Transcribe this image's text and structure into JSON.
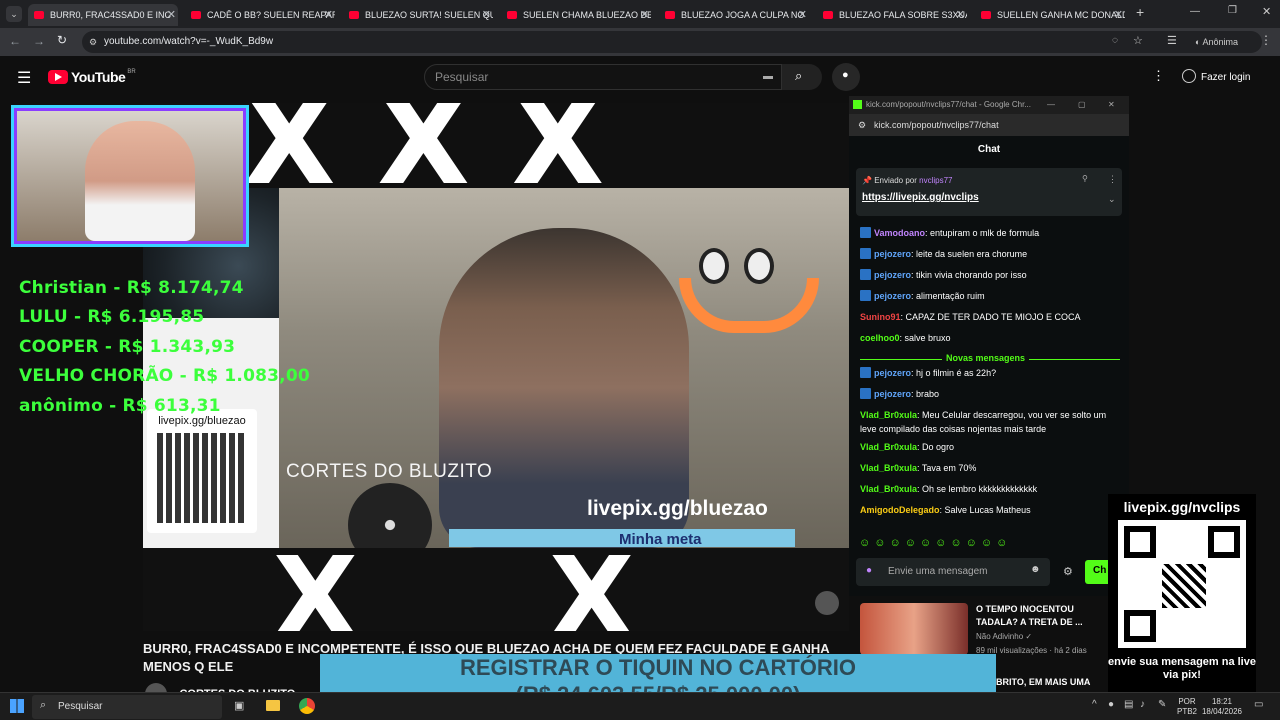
{
  "browser": {
    "tabs": [
      {
        "label": "BURR0, FRAC4SSAD0 E INC",
        "active": true
      },
      {
        "label": "CADÊ O BB? SUELEN REAPARE"
      },
      {
        "label": "BLUEZAO SURTA! SUELEN QUE"
      },
      {
        "label": "SUELEN CHAMA BLUEZAO DE"
      },
      {
        "label": "BLUEZAO JOGA A CULPA NO"
      },
      {
        "label": "BLUEZAO FALA SOBRE S3XUAL"
      },
      {
        "label": "SUELLEN GANHA MC DONALD"
      }
    ],
    "url": "youtube.com/watch?v=-_WudK_Bd9w",
    "profile_label": "Anônima"
  },
  "youtube": {
    "logo": "YouTube",
    "region": "BR",
    "search_placeholder": "Pesquisar",
    "login_label": "Fazer login"
  },
  "video": {
    "title": "BURR0, FRAC4SSAD0 E INCOMPETENTE, É ISSO QUE BLUEZAO ACHA DE QUEM FEZ FACULDADE E GANHA MENOS Q ELE",
    "channel": "CORTES DO BLUZITO",
    "overlay_channel_text": "CORTES DO BLUZITO",
    "livepix_text": "livepix.gg/bluezao",
    "meta_label": "Minha meta",
    "qr_label": "livepix.gg/bluezao",
    "donors": [
      "Christian - R$ 8.174,74",
      "LULU - R$ 6.195,85",
      "COOPER - R$ 1.343,93",
      "VELHO CHORÃO - R$ 1.083,00",
      "anônimo - R$ 613,31"
    ]
  },
  "chat_popup": {
    "window_title": "kick.com/popout/nvclips77/chat - Google Chr...",
    "url": "kick.com/popout/nvclips77/chat",
    "header": "Chat",
    "pinned_label": "Enviado por",
    "pinned_user": "nvclips77",
    "pinned_link": "https://livepix.gg/nvclips",
    "new_messages_label": "Novas mensagens",
    "input_placeholder": "Envie uma mensagem",
    "send_label": "Ch",
    "messages": [
      {
        "user": "Vamodoano",
        "text": "entupiram o mlk de formula",
        "color": "#c084fc",
        "badge": true
      },
      {
        "user": "pejozero",
        "text": "leite da suelen era chorume",
        "color": "#60a5fa",
        "badge": true
      },
      {
        "user": "pejozero",
        "text": "tikin vivia chorando por isso",
        "color": "#60a5fa",
        "badge": true
      },
      {
        "user": "pejozero",
        "text": "alimentação ruim",
        "color": "#60a5fa",
        "badge": true
      },
      {
        "user": "Sunino91",
        "text": "CAPAZ DE TER DADO TE MIOJO E COCA",
        "color": "#ef4444",
        "badge": false
      },
      {
        "user": "coelhoo0",
        "text": "salve bruxo",
        "color": "#53fc18",
        "badge": false
      },
      {
        "user": "pejozero",
        "text": "hj o filmin é as 22h?",
        "color": "#60a5fa",
        "badge": true
      },
      {
        "user": "pejozero",
        "text": "brabo",
        "color": "#60a5fa",
        "badge": true
      },
      {
        "user": "Vlad_Br0xula",
        "text": "Meu Celular descarregou, vou ver se solto um leve compilado das coisas nojentas mais tarde",
        "color": "#53fc18",
        "badge": false
      },
      {
        "user": "Vlad_Br0xula",
        "text": "Do ogro",
        "color": "#53fc18",
        "badge": false
      },
      {
        "user": "Vlad_Br0xula",
        "text": "Tava em 70%",
        "color": "#53fc18",
        "badge": false
      },
      {
        "user": "Vlad_Br0xula",
        "text": "Oh se lembro kkkkkkkkkkkkk",
        "color": "#53fc18",
        "badge": false
      },
      {
        "user": "AmigodoDelegado",
        "text": "Salve Lucas Matheus",
        "color": "#facc15",
        "badge": false
      }
    ]
  },
  "sidebar_recs": [
    {
      "title": "O TEMPO INOCENTOU TADALA? A TRETA DE ...",
      "channel": "Não Adivinho",
      "meta": "89 mil visualizações · há 2 dias"
    },
    {
      "title": "BRITO, EM MAIS UMA",
      "channel": "",
      "meta": ""
    }
  ],
  "qr_overlay": {
    "top_text": "livepix.gg/nvclips",
    "bottom_text": "envie sua mensagem na live via pix!"
  },
  "goal_banner": {
    "line1": "REGISTRAR O TIQUIN NO CARTÓRIO",
    "line2": "(R$ 24.603,55/R$ 25.000,00)",
    "progress": 0.984
  },
  "taskbar": {
    "search_placeholder": "Pesquisar",
    "lang": "POR",
    "layout": "PTB2",
    "time": "18:21",
    "date": "18/04/2026"
  },
  "colors": {
    "accent_green": "#53fc18",
    "youtube_red": "#ff0033",
    "donor_green": "#3cff3c",
    "goal_blue": "#52b4d8"
  }
}
